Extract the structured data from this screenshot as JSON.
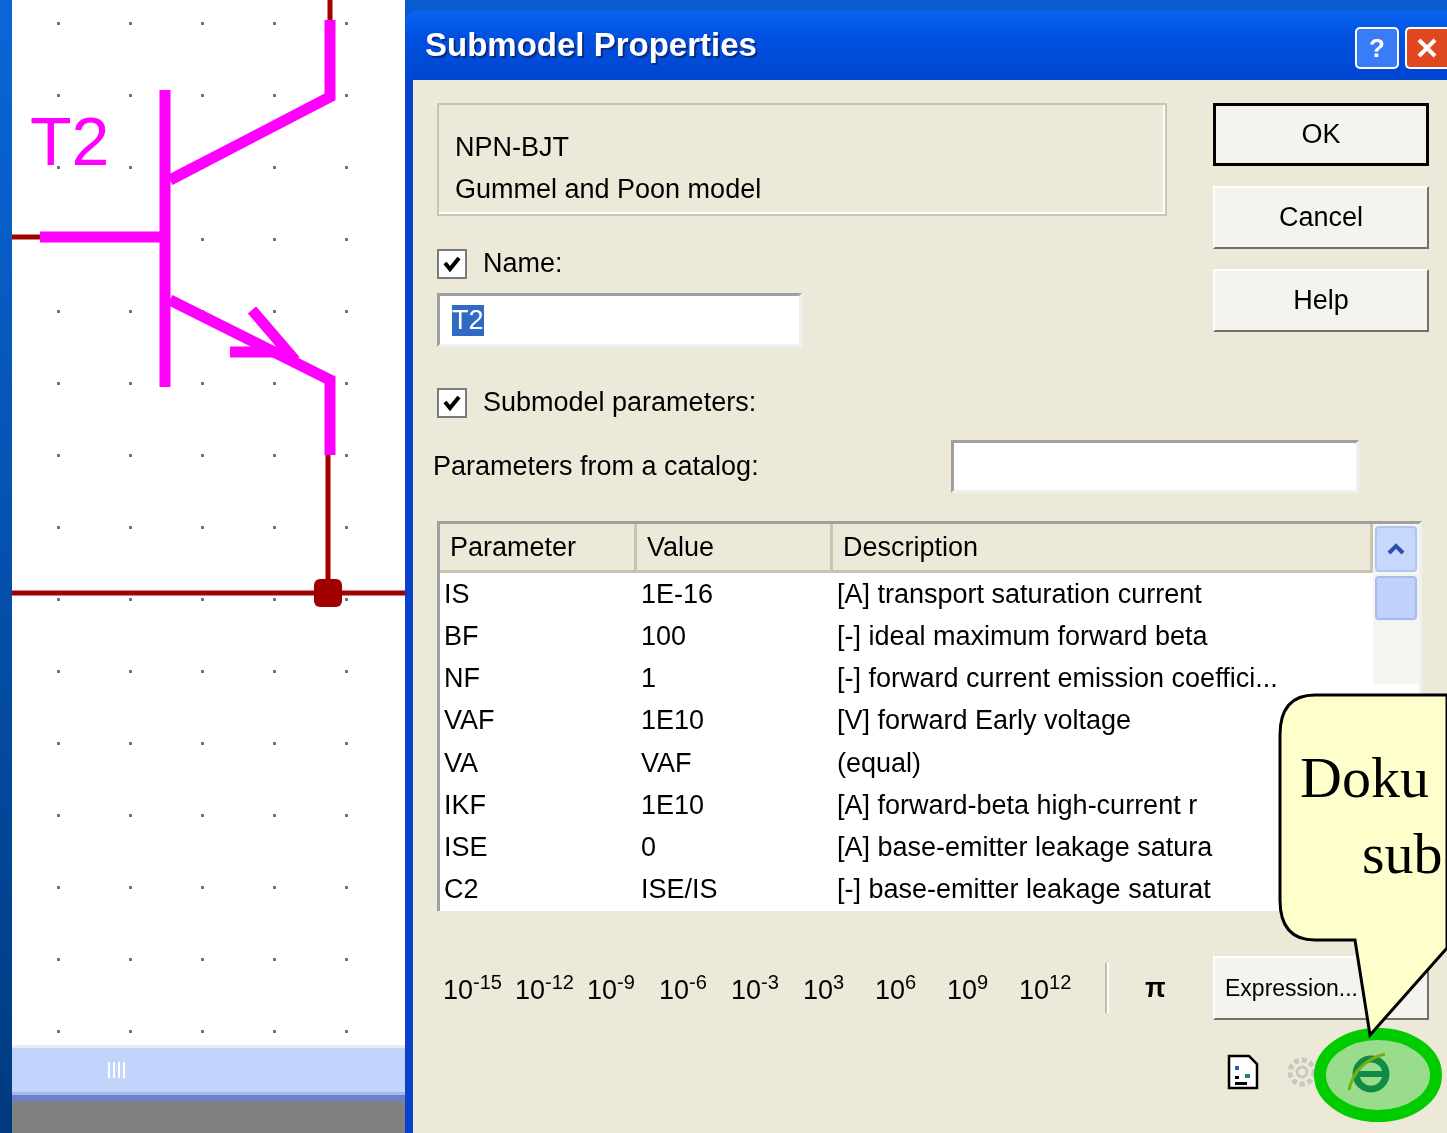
{
  "schematic": {
    "component_label": "T2"
  },
  "window": {
    "title": "Submodel Properties",
    "help_button": "?"
  },
  "info": {
    "lines": [
      "NPN-BJT",
      "Gummel and Poon model"
    ]
  },
  "buttons": [
    {
      "label": "OK",
      "default": true
    },
    {
      "label": "Cancel",
      "default": false
    },
    {
      "label": "Help",
      "default": false
    }
  ],
  "name": {
    "label": "Name:",
    "checked": true,
    "value": "T2",
    "text_selected": true
  },
  "submodel_parameters": {
    "label": "Submodel parameters:",
    "checked": true
  },
  "catalog": {
    "label": "Parameters from a catalog:"
  },
  "table": {
    "columns": [
      "Parameter",
      "Value",
      "Description"
    ],
    "rows": [
      {
        "parameter": "IS",
        "value": "1E-16",
        "description": "[A] transport saturation current"
      },
      {
        "parameter": "BF",
        "value": "100",
        "description": "[-] ideal maximum forward beta"
      },
      {
        "parameter": "NF",
        "value": "1",
        "description": "[-] forward current emission coeffici..."
      },
      {
        "parameter": "VAF",
        "value": "1E10",
        "description": "[V] forward Early voltage"
      },
      {
        "parameter": "VA",
        "value": "VAF",
        "description": "(equal)"
      },
      {
        "parameter": "IKF",
        "value": "1E10",
        "description": "[A] forward-beta high-current r"
      },
      {
        "parameter": "ISE",
        "value": "0",
        "description": "[A] base-emitter leakage satura"
      },
      {
        "parameter": "C2",
        "value": "ISE/IS",
        "description": "[-] base-emitter leakage saturat"
      }
    ]
  },
  "multipliers": [
    "10$^{-15}$",
    "10$^{-12}$",
    "10$^{-9}$",
    "10$^{-6}$",
    "10$^{-3}$",
    "10$^{3}$",
    "10$^{6}$",
    "10$^{9}$",
    "10$^{12}$"
  ],
  "pi": "π",
  "expression_button": "Expression...",
  "callout": {
    "lines": [
      "Doku",
      "sub"
    ]
  }
}
